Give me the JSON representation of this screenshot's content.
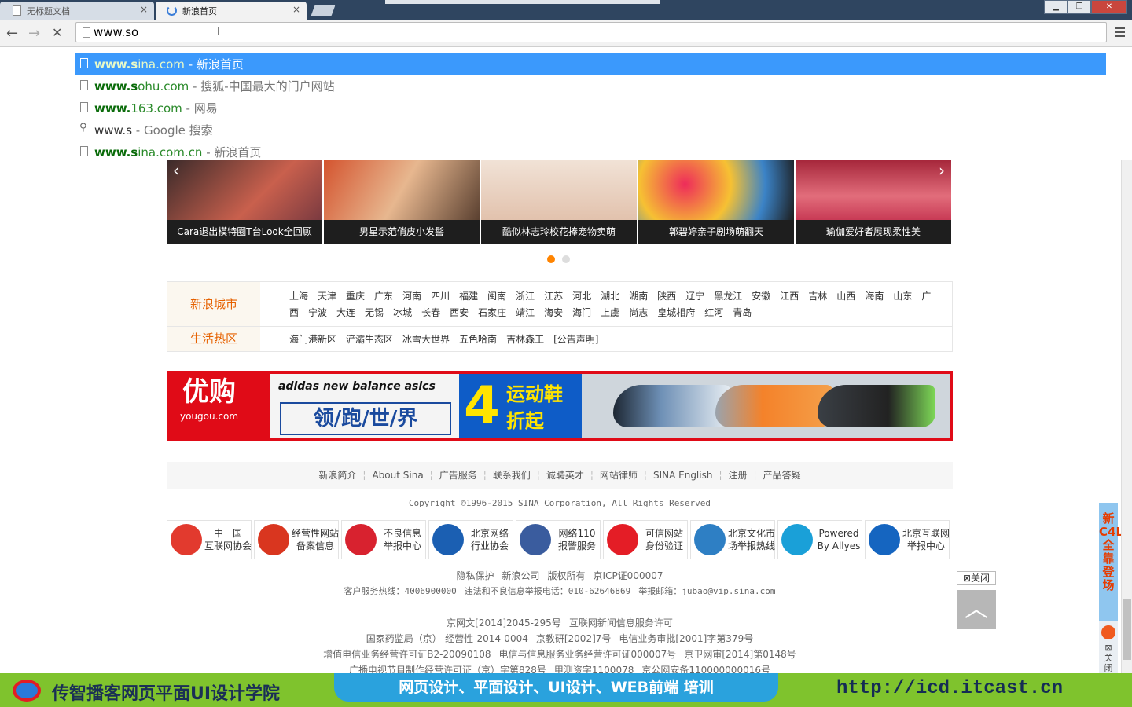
{
  "tabs": [
    {
      "title": "无标题文档",
      "close": "×"
    },
    {
      "title": "新浪首页",
      "close": "×"
    }
  ],
  "window_controls": {
    "minimize": "▁",
    "maximize": "❐",
    "close": "✕"
  },
  "toolbar": {
    "back": "←",
    "forward": "→",
    "stop": "✕",
    "address": "www.so"
  },
  "suggestions": [
    {
      "url_bold": "www.s",
      "url_rest": "ina.com",
      "title": " - 新浪首页",
      "type": "page"
    },
    {
      "url_bold": "www.s",
      "url_rest": "ohu.com",
      "title": " - 搜狐-中国最大的门户网站",
      "type": "page"
    },
    {
      "url_bold": "www.",
      "url_rest": "163.com",
      "title": " - 网易",
      "type": "page"
    },
    {
      "url_bold": "",
      "url_rest": "www.s",
      "title": " - Google 搜索",
      "type": "search"
    },
    {
      "url_bold": "www.s",
      "url_rest": "ina.com.cn",
      "title": " - 新浪首页",
      "type": "page"
    }
  ],
  "carousel": {
    "prev": "‹",
    "next": "›",
    "slides": [
      {
        "caption": "Cara退出模特圈T台Look全回顾",
        "color": "#6e3b3b"
      },
      {
        "caption": "男星示范俏皮小发髻",
        "color": "#9a6a45"
      },
      {
        "caption": "酷似林志玲校花捧宠物卖萌",
        "color": "#e8d6c8"
      },
      {
        "caption": "郭碧婷亲子剧场萌翻天",
        "color": "#d8456a"
      },
      {
        "caption": "瑜伽爱好者展现柔性美",
        "color": "#b1344c"
      }
    ]
  },
  "cities": {
    "label1": "新浪城市",
    "label2": "生活热区",
    "list": [
      "上海",
      "天津",
      "重庆",
      "广东",
      "河南",
      "四川",
      "福建",
      "闽南",
      "浙江",
      "江苏",
      "河北",
      "湖北",
      "湖南",
      "陕西",
      "辽宁",
      "黑龙江",
      "安徽",
      "江西",
      "吉林",
      "山西",
      "海南",
      "山东",
      "广西",
      "宁波",
      "大连",
      "无锡",
      "冰城",
      "长春",
      "西安",
      "石家庄",
      "靖江",
      "海安",
      "海门",
      "上虞",
      "尚志",
      "皇城相府",
      "红河",
      "青岛"
    ],
    "hot": [
      "海门港新区",
      "浐灞生态区",
      "冰雪大世界",
      "五色哈南",
      "吉林森工",
      "[公告声明]"
    ]
  },
  "ad": {
    "logo": "优购",
    "logo_sub": "yougou.com",
    "brands": "adidas  new balance  asics",
    "slogan": "领/跑/世/界",
    "number": "4",
    "line1": "运动鞋",
    "line2": "折起"
  },
  "footer_nav": [
    "新浪简介",
    "About Sina",
    "广告服务",
    "联系我们",
    "诚聘英才",
    "网站律师",
    "SINA English",
    "注册",
    "产品答疑"
  ],
  "copyright": "Copyright ©1996-2015 SINA Corporation, All Rights Reserved",
  "badges": [
    {
      "line1": "中　国",
      "line2": "互联网协会",
      "color": "#e23a2e"
    },
    {
      "line1": "经营性网站",
      "line2": "备案信息",
      "color": "#d9361f"
    },
    {
      "line1": "不良信息",
      "line2": "举报中心",
      "color": "#d8222f"
    },
    {
      "line1": "北京网络",
      "line2": "行业协会",
      "color": "#1b5fb2"
    },
    {
      "line1": "网络110",
      "line2": "报警服务",
      "color": "#3a5c9e"
    },
    {
      "line1": "可信网站",
      "line2": "身份验证",
      "color": "#e41d26"
    },
    {
      "line1": "北京文化市",
      "line2": "场举报热线",
      "color": "#2e7fc4"
    },
    {
      "line1": "Powered",
      "line2": "By Allyes",
      "color": "#1aa0d8"
    },
    {
      "line1": "北京互联网",
      "line2": "举报中心",
      "color": "#1565c0"
    }
  ],
  "footer_links": {
    "line1": [
      "隐私保护",
      "新浪公司",
      "版权所有",
      "京ICP证000007"
    ],
    "line2": [
      "客户服务热线：4006900000",
      "违法和不良信息举报电话：010-62646869",
      "举报邮箱：jubao@vip.sina.com"
    ],
    "line3": [
      "京网文[2014]2045-295号",
      "互联网新闻信息服务许可"
    ],
    "line4": [
      "国家药监局（京）-经营性-2014-0004",
      "京教研[2002]7号",
      "电信业务审批[2001]字第379号"
    ],
    "line5": [
      "增值电信业务经营许可证B2-20090108",
      "电信与信息服务业务经营许可证000007号",
      "京卫网审[2014]第0148号"
    ],
    "line6": [
      "广播电视节目制作经营许可证（京）字第828号",
      "甲测资字1100078",
      "京公网安备110000000016号"
    ]
  },
  "float_close": "⊠关闭",
  "to_top": "︿",
  "side_banner": {
    "text": "新C4L全靠登场",
    "close": "⊠关闭"
  },
  "bottom_banner": {
    "school": "传智播客网页平面UI设计学院",
    "courses": "网页设计、平面设计、UI设计、WEB前端 培训",
    "url": "http://icd.itcast.cn"
  }
}
